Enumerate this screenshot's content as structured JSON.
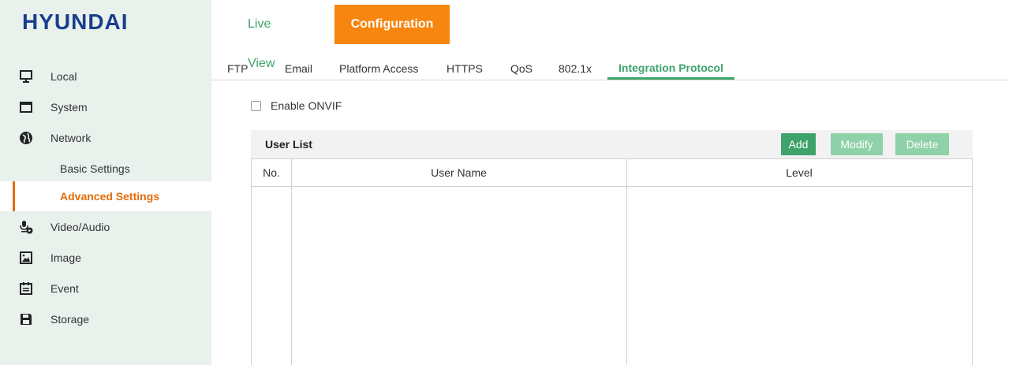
{
  "header": {
    "logo": "HYUNDAI",
    "nav": [
      {
        "label": "Live View"
      },
      {
        "label": "Configuration"
      }
    ]
  },
  "sidebar": {
    "items": [
      {
        "label": "Local",
        "icon": "monitor-icon"
      },
      {
        "label": "System",
        "icon": "window-icon"
      },
      {
        "label": "Network",
        "icon": "globe-icon"
      },
      {
        "label": "Basic Settings"
      },
      {
        "label": "Advanced Settings"
      },
      {
        "label": "Video/Audio",
        "icon": "mic-play-icon"
      },
      {
        "label": "Image",
        "icon": "image-icon"
      },
      {
        "label": "Event",
        "icon": "calendar-icon"
      },
      {
        "label": "Storage",
        "icon": "save-icon"
      }
    ]
  },
  "subtabs": [
    "FTP",
    "Email",
    "Platform Access",
    "HTTPS",
    "QoS",
    "802.1x",
    "Integration Protocol"
  ],
  "onvif": {
    "label": "Enable ONVIF",
    "checked": false
  },
  "user_list": {
    "title": "User List",
    "buttons": {
      "add": "Add",
      "modify": "Modify",
      "delete": "Delete"
    },
    "columns": [
      "No.",
      "User Name",
      "Level"
    ],
    "rows": []
  },
  "colors": {
    "accent": "#f6860f",
    "green": "#3ea36b",
    "active": "#e46c0a",
    "sidebar_bg": "#e8f1ec"
  }
}
